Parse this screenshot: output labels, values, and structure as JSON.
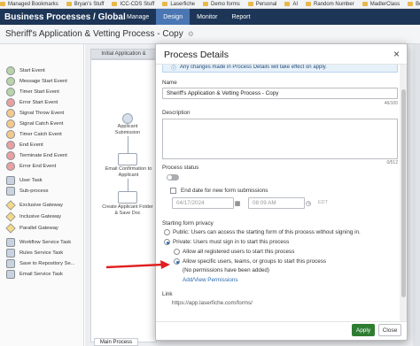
{
  "bookmarks": [
    "Managed Bookmarks",
    "Bryan's Stuff",
    "ICC-CDS Stuff",
    "Laserfiche",
    "Demo forms",
    "Personal",
    "AI",
    "Random Number",
    "MadlerClass",
    "Bookmarks"
  ],
  "appbar": {
    "title": "Business Processes / Global",
    "tabs": [
      "Manage",
      "Design",
      "Monitor",
      "Report"
    ],
    "active_tab": "Design"
  },
  "subbar": {
    "process_name": "Sheriff's Application & Vetting Process - Copy"
  },
  "palette": {
    "items": [
      {
        "label": "Start Event",
        "icon": "start-event-icon",
        "color": "#b8d4a8"
      },
      {
        "label": "Message Start Event",
        "icon": "message-start-icon",
        "color": "#b8d4a8"
      },
      {
        "label": "Timer Start Event",
        "icon": "timer-start-icon",
        "color": "#b8d4a8"
      },
      {
        "label": "Error Start Event",
        "icon": "error-start-icon",
        "color": "#e8a0a0"
      },
      {
        "label": "Signal Throw Event",
        "icon": "signal-throw-icon",
        "color": "#f3c98b"
      },
      {
        "label": "Signal Catch Event",
        "icon": "signal-catch-icon",
        "color": "#f3c98b"
      },
      {
        "label": "Timer Catch Event",
        "icon": "timer-catch-icon",
        "color": "#f3c98b"
      },
      {
        "label": "End Event",
        "icon": "end-event-icon",
        "color": "#e8a0a0"
      },
      {
        "label": "Terminate End Event",
        "icon": "terminate-end-icon",
        "color": "#e8a0a0"
      },
      {
        "label": "Error End Event",
        "icon": "error-end-icon",
        "color": "#e8a0a0"
      },
      {
        "label": "User Task",
        "icon": "user-task-icon",
        "color": "#c9d3e0"
      },
      {
        "label": "Sub-process",
        "icon": "sub-process-icon",
        "color": "#c9d3e0"
      },
      {
        "label": "Exclusive Gateway",
        "icon": "exclusive-gateway-icon",
        "color": "#f3d98b"
      },
      {
        "label": "Inclusive Gateway",
        "icon": "inclusive-gateway-icon",
        "color": "#f3d98b"
      },
      {
        "label": "Parallel Gateway",
        "icon": "parallel-gateway-icon",
        "color": "#f3d98b"
      },
      {
        "label": "Workflow Service Task",
        "icon": "workflow-service-icon",
        "color": "#c9d3e0"
      },
      {
        "label": "Rules Service Task",
        "icon": "rules-service-icon",
        "color": "#c9d3e0"
      },
      {
        "label": "Save to Repository Se...",
        "icon": "save-repository-icon",
        "color": "#c9d3e0"
      },
      {
        "label": "Email Service Task",
        "icon": "email-service-icon",
        "color": "#c9d3e0"
      }
    ]
  },
  "canvas": {
    "lane_header": "Initial Application &",
    "nodes": [
      "Applicant Submission",
      "Email Confirmation to Applicant",
      "Create Applicant Folder & Save Doc"
    ],
    "bottom_tab": "Main Process"
  },
  "modal": {
    "title": "Process Details",
    "close_icon": "×",
    "info_text": "Any changes made in Process Details will take effect on apply.",
    "name_label": "Name",
    "name_value": "Sheriff's Application & Vetting Process - Copy",
    "name_counter": "46/100",
    "description_label": "Description",
    "description_counter": "0/512",
    "status_label": "Process status",
    "end_date_label": "End date for new form submissions",
    "date_value": "04/17/2024",
    "time_value": "08:09 AM",
    "timezone": "EDT",
    "privacy_label": "Starting form privacy",
    "privacy_public": "Public: Users can access the starting form of this process without signing in.",
    "privacy_private": "Private: Users must sign in to start this process",
    "allow_all": "Allow all registered users to start this process",
    "allow_specific": "Allow specific users, teams, or groups to start this process",
    "no_permissions": "(No permissions have been added)",
    "add_view_link": "Add/View Permissions",
    "link_label": "Link",
    "link_value": "https://app.laserfiche.com/forms/",
    "apply_label": "Apply",
    "close_label": "Close"
  },
  "annotation": {
    "arrow_color": "#e02020"
  }
}
